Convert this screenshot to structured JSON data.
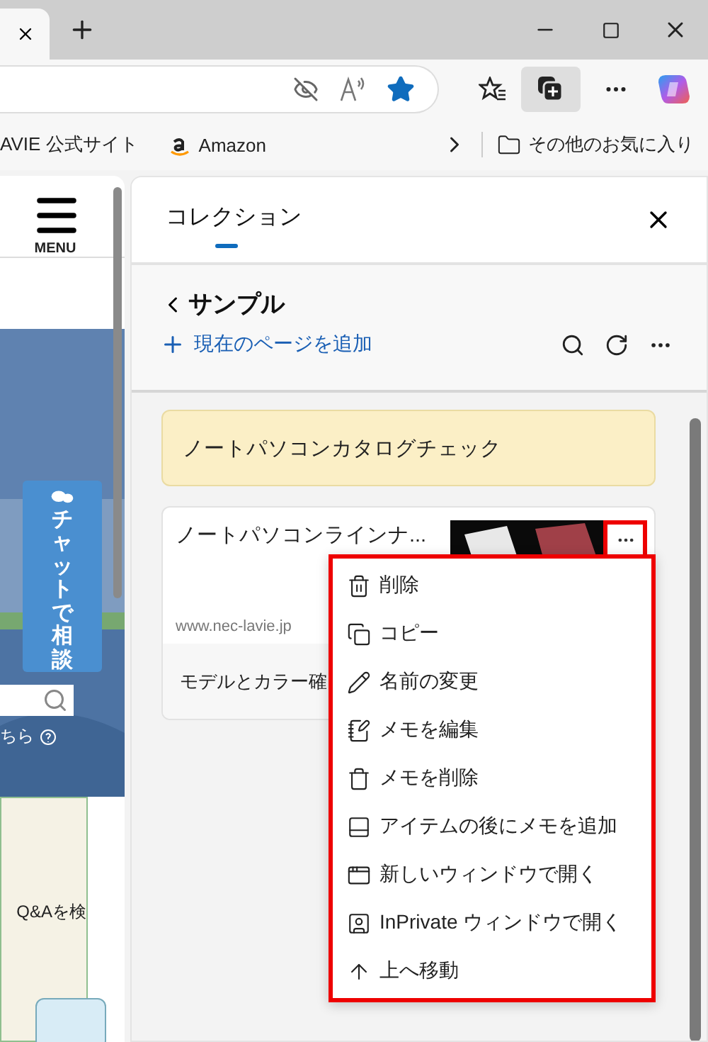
{
  "browser": {
    "bookmarks": [
      {
        "label": "AVIE 公式サイト",
        "kind": "plain"
      },
      {
        "label": "Amazon",
        "kind": "amazon"
      }
    ],
    "other_favorites": "その他のお気に入り",
    "favorite": true
  },
  "page": {
    "menu_label": "MENU",
    "chat_button": "チャットで相談",
    "search_hint": "ちら",
    "box_text": "Q&Aを検"
  },
  "collections": {
    "title": "コレクション",
    "collection_name": "サンプル",
    "add_page": "現在のページを追加",
    "items": [
      {
        "kind": "note",
        "text": "ノートパソコンカタログチェック"
      },
      {
        "kind": "page",
        "title": "ノートパソコンラインナ...",
        "url": "www.nec-lavie.jp",
        "note": "モデルとカラー確"
      }
    ],
    "context_menu": [
      {
        "kind": "trash",
        "label": "削除"
      },
      {
        "kind": "copy",
        "label": "コピー"
      },
      {
        "kind": "rename",
        "label": "名前の変更"
      },
      {
        "kind": "edit_note",
        "label": "メモを編集"
      },
      {
        "kind": "delete_note",
        "label": "メモを削除"
      },
      {
        "kind": "add_note",
        "label": "アイテムの後にメモを追加"
      },
      {
        "kind": "new_window",
        "label": "新しいウィンドウで開く"
      },
      {
        "kind": "inprivate",
        "label": "InPrivate ウィンドウで開く"
      },
      {
        "kind": "move_up",
        "label": "上へ移動"
      }
    ]
  }
}
